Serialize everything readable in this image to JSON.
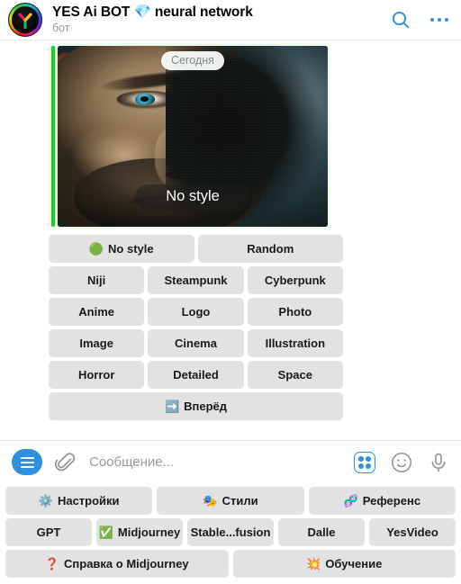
{
  "header": {
    "title": "YES Ai BOT 💎 neural network",
    "subtitle": "бот",
    "search_icon": "search-icon",
    "menu_icon": "more-options-icon",
    "avatar_alt": "YES Ai BOT avatar"
  },
  "message": {
    "date_separator": "Сегодня",
    "photo_caption": "No style",
    "photo_alt": "Close-up portrait of a man's face, half lit half in shadow"
  },
  "inline_keyboard": {
    "rows": [
      [
        {
          "label": "No style",
          "emoji": "🟢"
        },
        {
          "label": "Random",
          "emoji": ""
        }
      ],
      [
        {
          "label": "Niji",
          "emoji": ""
        },
        {
          "label": "Steampunk",
          "emoji": ""
        },
        {
          "label": "Cyberpunk",
          "emoji": ""
        }
      ],
      [
        {
          "label": "Anime",
          "emoji": ""
        },
        {
          "label": "Logo",
          "emoji": ""
        },
        {
          "label": "Photo",
          "emoji": ""
        }
      ],
      [
        {
          "label": "Image",
          "emoji": ""
        },
        {
          "label": "Cinema",
          "emoji": ""
        },
        {
          "label": "Illustration",
          "emoji": ""
        }
      ],
      [
        {
          "label": "Horror",
          "emoji": ""
        },
        {
          "label": "Detailed",
          "emoji": ""
        },
        {
          "label": "Space",
          "emoji": ""
        }
      ],
      [
        {
          "label": "Вперёд",
          "emoji": "➡️"
        }
      ]
    ]
  },
  "composer": {
    "menu_icon": "hamburger-menu-icon",
    "attach_icon": "paperclip-icon",
    "placeholder": "Сообщение...",
    "keyboard_icon": "bot-commands-grid-icon",
    "emoji_icon": "smiley-icon",
    "voice_icon": "microphone-icon"
  },
  "reply_keyboard": {
    "rows": [
      [
        {
          "label": "Настройки",
          "emoji": "⚙️"
        },
        {
          "label": "Стили",
          "emoji": "🎭"
        },
        {
          "label": "Референс",
          "emoji": "🧬"
        }
      ],
      [
        {
          "label": "GPT",
          "emoji": ""
        },
        {
          "label": "Midjourney",
          "emoji": "✅"
        },
        {
          "label": "Stable...fusion",
          "emoji": ""
        },
        {
          "label": "Dalle",
          "emoji": ""
        },
        {
          "label": "YesVideo",
          "emoji": ""
        }
      ],
      [
        {
          "label": "Справка о Midjourney",
          "emoji": "❓"
        },
        {
          "label": "Обучение",
          "emoji": "💥"
        }
      ]
    ]
  },
  "colors": {
    "accent_blue": "#2f8fe0",
    "button_gray": "#e2e2e2",
    "bubble_green": "#eefbee",
    "bar_green": "#14d614",
    "muted_text": "#9a9a9a"
  }
}
